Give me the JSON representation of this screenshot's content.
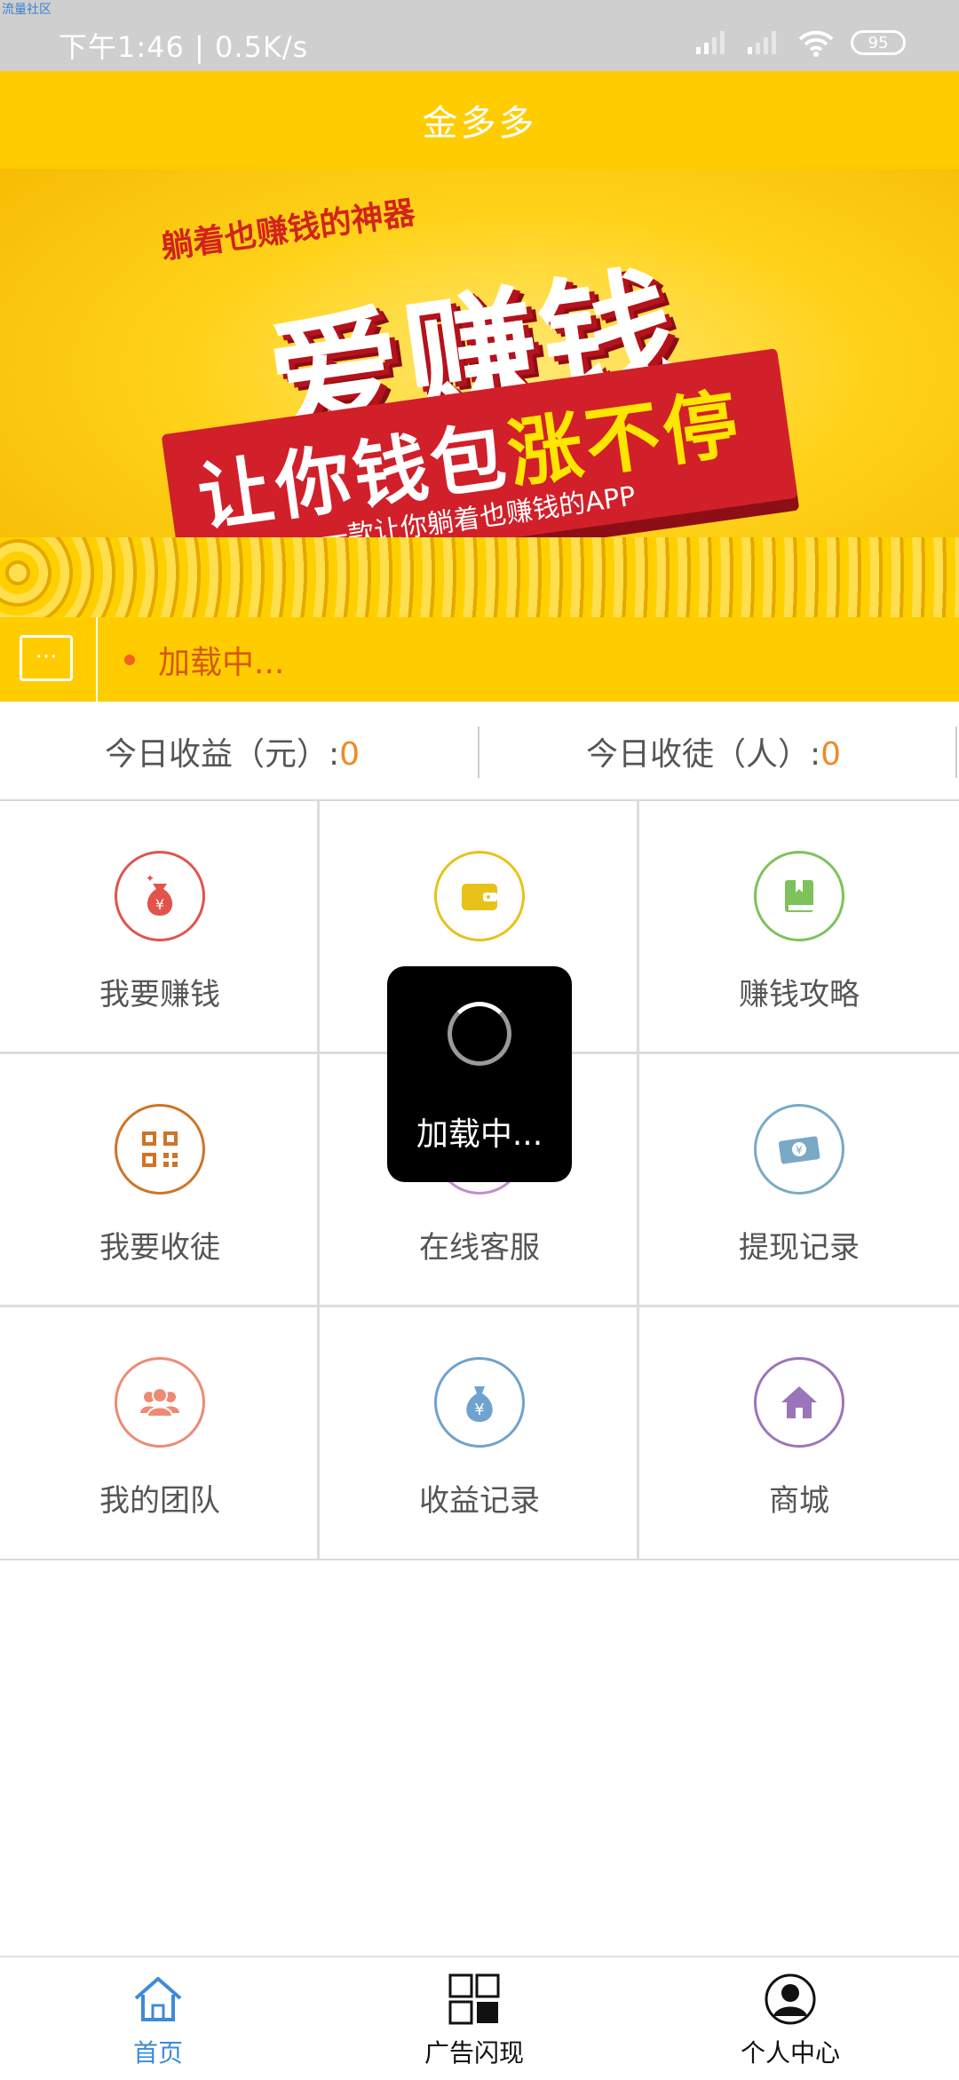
{
  "watermark": "流量社区",
  "status_bar": {
    "time": "下午1:46 | 0.5K/s",
    "battery": "95"
  },
  "header": {
    "title": "金多多"
  },
  "banner": {
    "subtitle": "躺着也赚钱的神器",
    "headline": "爱赚钱",
    "line_prefix": "让你钱包",
    "line_highlight": "涨不停",
    "tagline": "一款让你躺着也赚钱的APP"
  },
  "notice": {
    "icon": "message-icon",
    "text": "加载中..."
  },
  "stats": {
    "income_label": "今日收益（元）:",
    "income_value": "0",
    "apprentice_label": "今日收徒（人）:",
    "apprentice_value": "0"
  },
  "grid": {
    "items": [
      {
        "label": "我要赚钱",
        "icon": "money-bag-icon",
        "color": "#e2534b"
      },
      {
        "label": "",
        "icon": "wallet-icon",
        "color": "#e8c21a"
      },
      {
        "label": "赚钱攻略",
        "icon": "book-icon",
        "color": "#7dc25a"
      },
      {
        "label": "我要收徒",
        "icon": "qrcode-icon",
        "color": "#cf7426"
      },
      {
        "label": "在线客服",
        "icon": "headset-icon",
        "color": "#c58bd0"
      },
      {
        "label": "提现记录",
        "icon": "cash-icon",
        "color": "#79a9c7"
      },
      {
        "label": "我的团队",
        "icon": "team-icon",
        "color": "#ef8a72"
      },
      {
        "label": "收益记录",
        "icon": "yuan-bag-icon",
        "color": "#6fa2cf"
      },
      {
        "label": "商城",
        "icon": "home-icon",
        "color": "#9b75ba"
      }
    ]
  },
  "toast": {
    "text": "加载中..."
  },
  "nav": {
    "home": "首页",
    "ads": "广告闪现",
    "profile": "个人中心",
    "active_color": "#3d8bd8"
  }
}
